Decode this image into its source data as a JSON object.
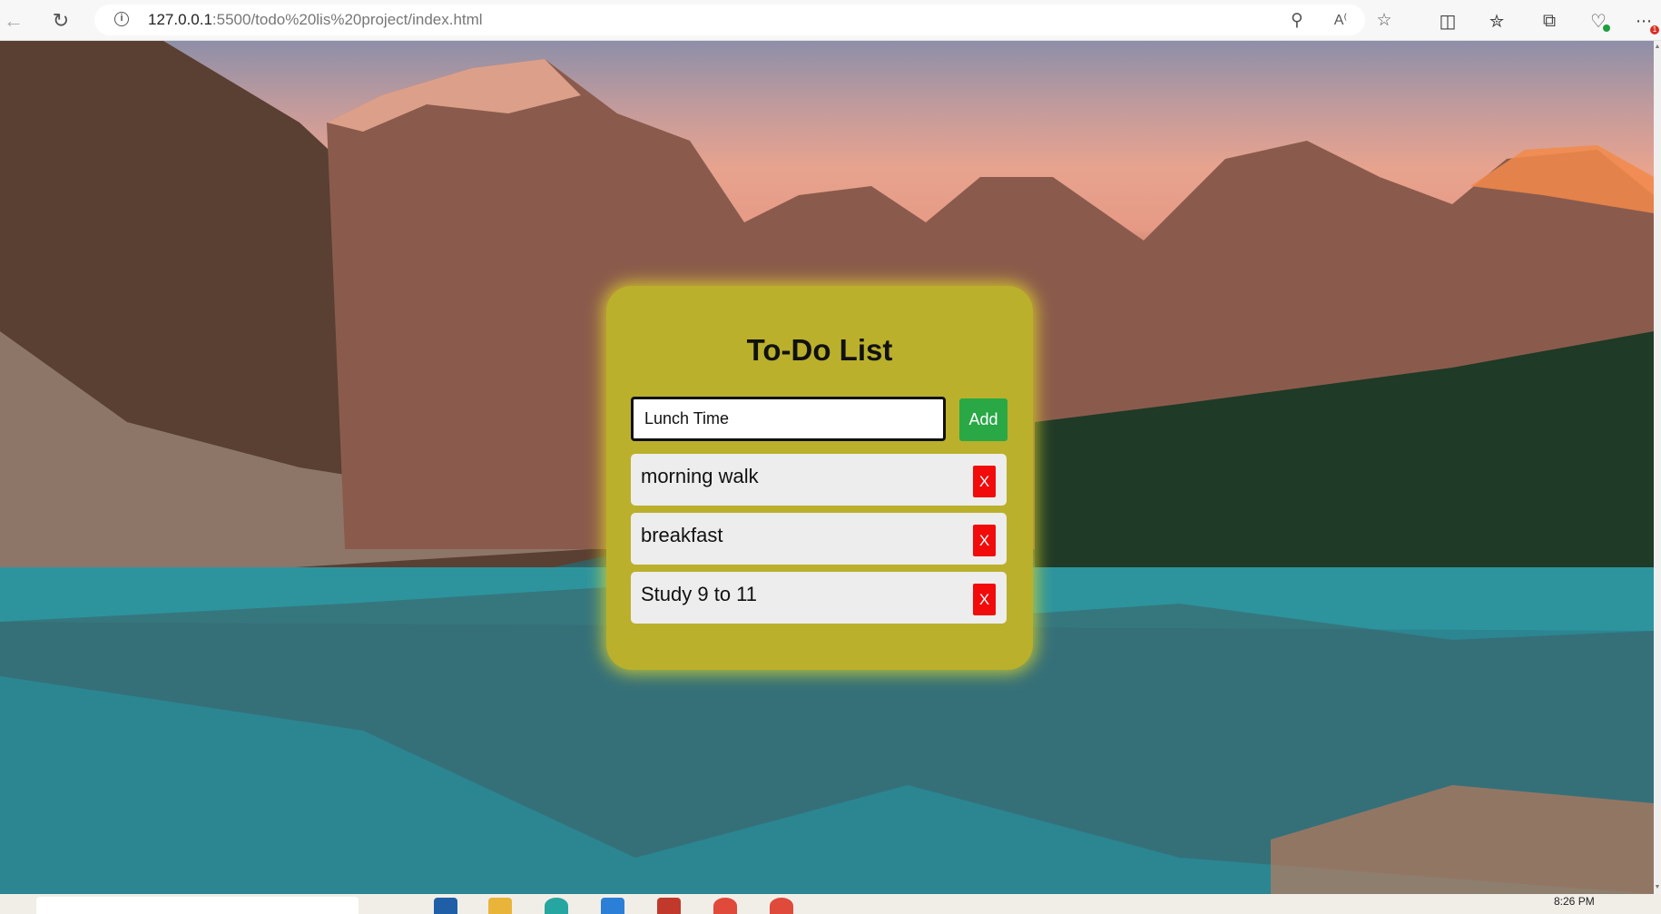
{
  "browser": {
    "url_host": "127.0.0.1",
    "url_rest": ":5500/todo%20lis%20project/index.html",
    "icons": [
      "back-arrow-icon",
      "reload-icon",
      "info-icon",
      "zoom-icon",
      "read-aloud-icon",
      "favorite-star-icon",
      "split-screen-icon",
      "favorites-icon",
      "collections-icon",
      "browser-essentials-icon",
      "more-icon"
    ],
    "notification_badge": "1"
  },
  "todo": {
    "title": "To-Do List",
    "input_value": "Lunch Time",
    "add_label": "Add",
    "delete_label": "X",
    "tasks": [
      "morning walk",
      "breakfast",
      "Study 9 to 11"
    ]
  },
  "taskbar": {
    "clock": "8:26 PM"
  },
  "colors": {
    "card": "#bab02c",
    "add_button": "#29a845",
    "delete_button": "#f20b0b",
    "task_bg": "#ededed"
  }
}
